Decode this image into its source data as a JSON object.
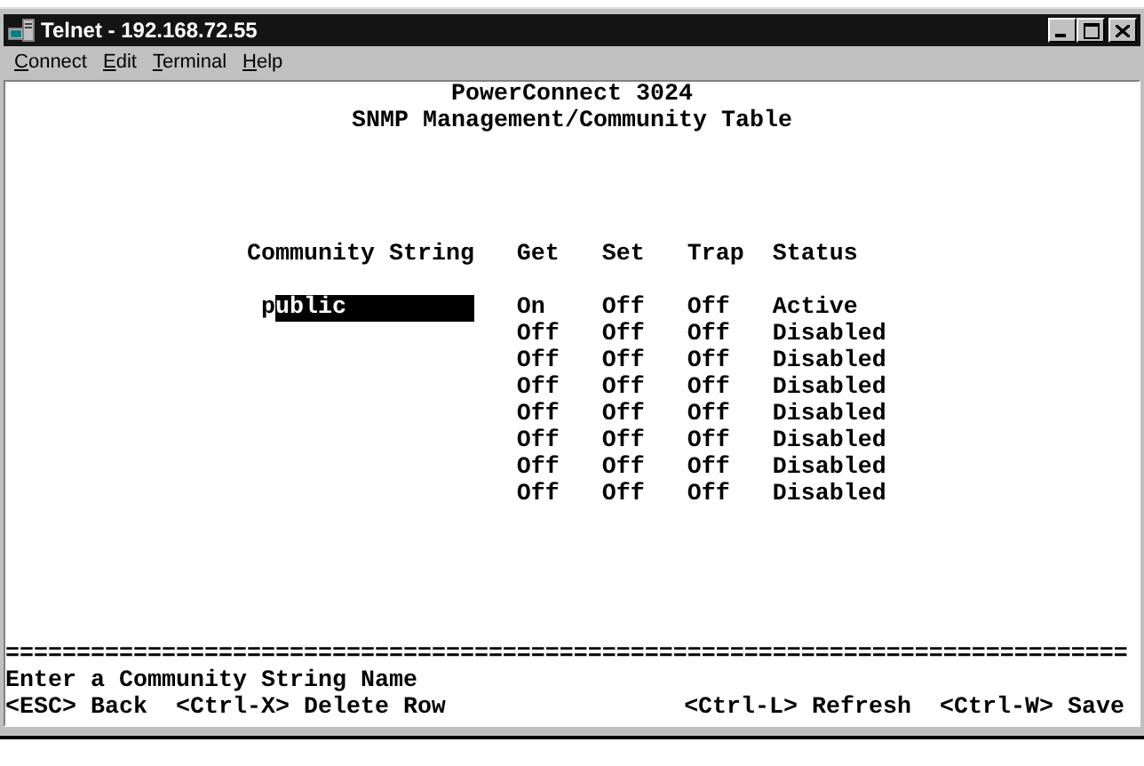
{
  "window": {
    "title": "Telnet - 192.168.72.55"
  },
  "menu": [
    {
      "label": "Connect"
    },
    {
      "label": "Edit"
    },
    {
      "label": "Terminal"
    },
    {
      "label": "Help"
    }
  ],
  "terminal": {
    "title": "PowerConnect 3024",
    "subtitle": "SNMP Management/Community Table",
    "columns": [
      "Community String",
      "Get",
      "Set",
      "Trap",
      "Status"
    ],
    "rows": [
      {
        "community_string": "public",
        "get": "On",
        "set": "Off",
        "trap": "Off",
        "status": "Active"
      },
      {
        "get": "Off",
        "set": "Off",
        "trap": "Off",
        "status": "Disabled"
      },
      {
        "get": "Off",
        "set": "Off",
        "trap": "Off",
        "status": "Disabled"
      },
      {
        "get": "Off",
        "set": "Off",
        "trap": "Off",
        "status": "Disabled"
      },
      {
        "get": "Off",
        "set": "Off",
        "trap": "Off",
        "status": "Disabled"
      },
      {
        "get": "Off",
        "set": "Off",
        "trap": "Off",
        "status": "Disabled"
      },
      {
        "get": "Off",
        "set": "Off",
        "trap": "Off",
        "status": "Disabled"
      },
      {
        "get": "Off",
        "set": "Off",
        "trap": "Off",
        "status": "Disabled"
      }
    ],
    "separator": "===============================================================================",
    "prompt": "Enter a Community String Name",
    "keys_left": [
      "<ESC> Back",
      "<Ctrl-X> Delete Row"
    ],
    "keys_right": [
      "<Ctrl-L> Refresh",
      "<Ctrl-W> Save"
    ]
  }
}
